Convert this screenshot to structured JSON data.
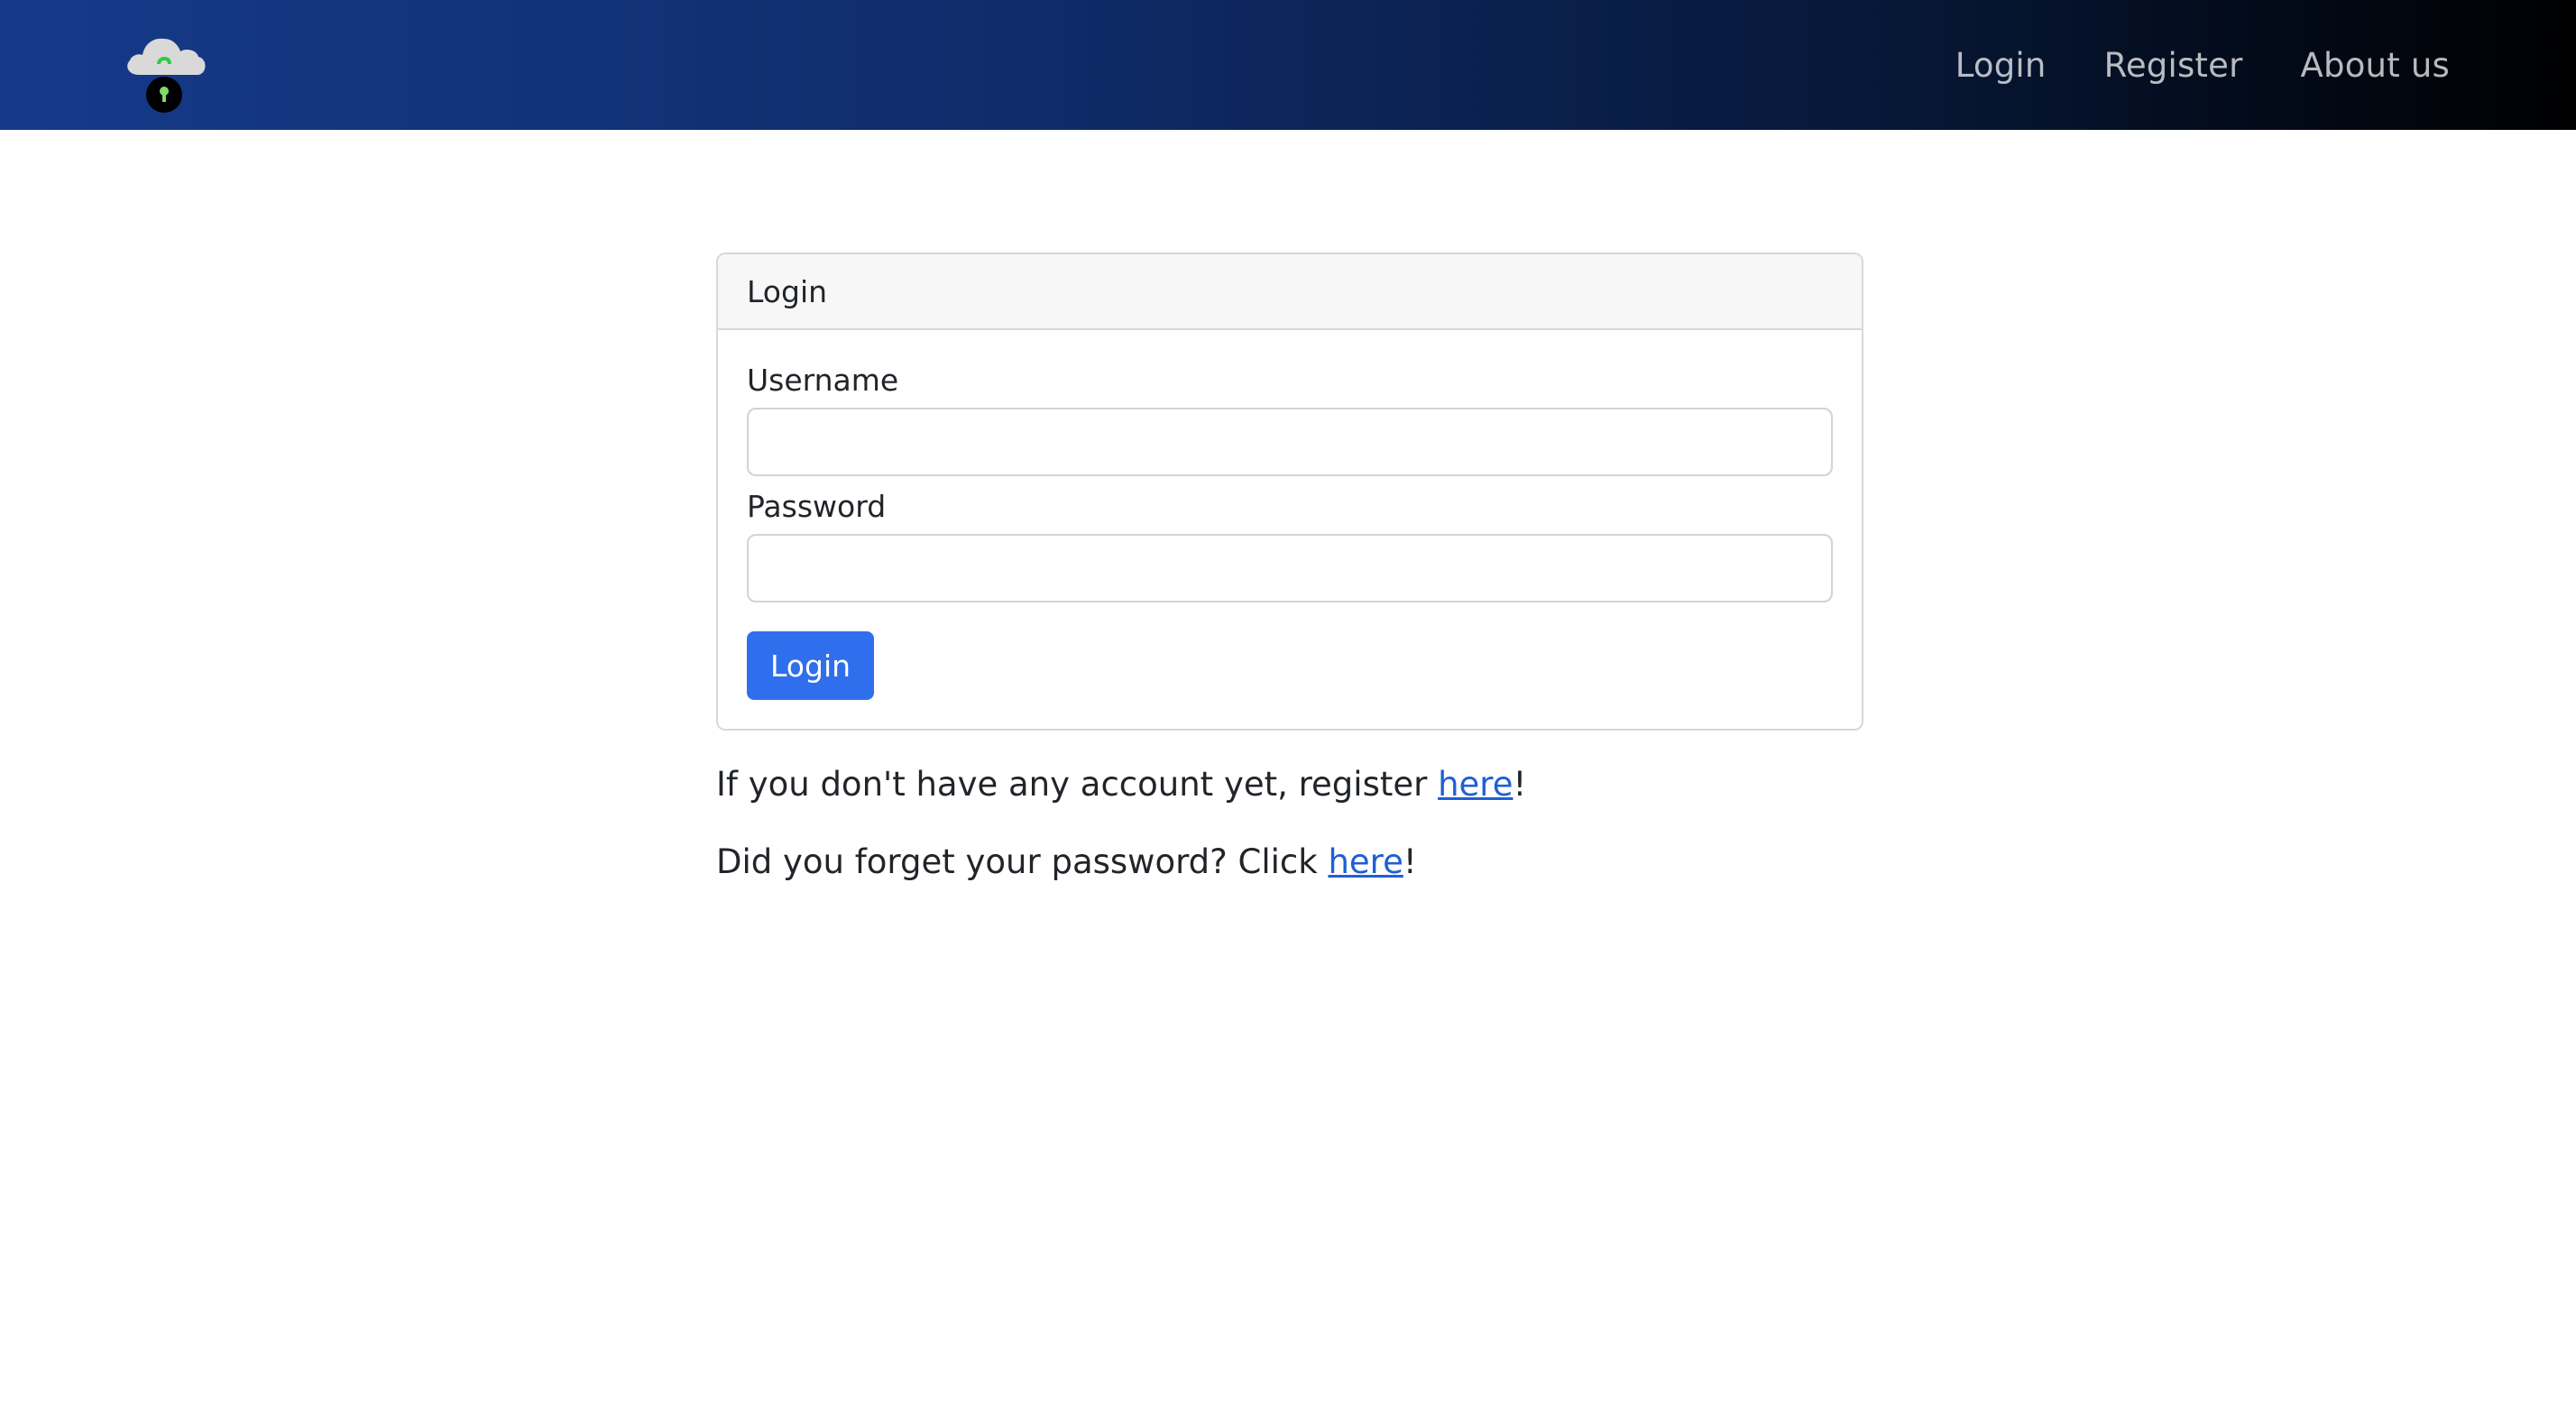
{
  "navbar": {
    "logo_icon": "cloud-lock-icon",
    "links": [
      {
        "label": "Login"
      },
      {
        "label": "Register"
      },
      {
        "label": "About us"
      }
    ]
  },
  "login_card": {
    "header": "Login",
    "username": {
      "label": "Username",
      "value": "",
      "placeholder": ""
    },
    "password": {
      "label": "Password",
      "value": "",
      "placeholder": ""
    },
    "submit_label": "Login"
  },
  "help": {
    "register": {
      "prefix": "If you don't have any account yet, register ",
      "link": "here",
      "suffix": "!"
    },
    "forgot": {
      "prefix": "Did you forget your password? Click ",
      "link": "here",
      "suffix": "!"
    }
  },
  "colors": {
    "primary_button": "#2f6fed",
    "link": "#1f5fd6",
    "navbar_start": "#163a8a",
    "navbar_end": "#000000"
  }
}
